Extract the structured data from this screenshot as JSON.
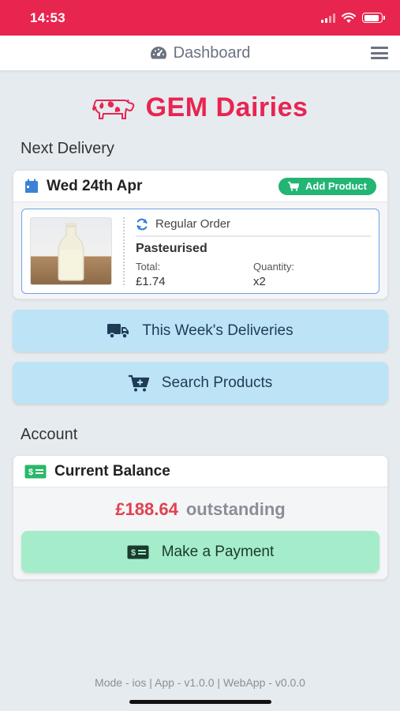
{
  "status_bar": {
    "time": "14:53",
    "battery_fraction": 0.9
  },
  "header": {
    "title": "Dashboard",
    "icon": "dashboard-gauge-icon",
    "menu_icon": "hamburger-menu-icon"
  },
  "brand": {
    "name": "GEM Dairies",
    "logo_icon": "cow-icon",
    "color": "#e8254f"
  },
  "next_delivery": {
    "section_title": "Next Delivery",
    "date": "Wed 24th Apr",
    "add_product_label": "Add Product",
    "order": {
      "type": "Regular Order",
      "product": "Pasteurised",
      "total_label": "Total:",
      "total_value": "£1.74",
      "quantity_label": "Quantity:",
      "quantity_value": "x2"
    }
  },
  "buttons": {
    "deliveries": "This Week's Deliveries",
    "search": "Search Products"
  },
  "account": {
    "section_title": "Account",
    "card_title": "Current Balance",
    "balance": "£188.64",
    "balance_status": "outstanding",
    "pay_label": "Make a Payment"
  },
  "footer": {
    "text": "Mode - ios | App - v1.0.0 | WebApp - v0.0.0"
  },
  "colors": {
    "accent": "#e8254f",
    "success": "#22b573",
    "info_button": "#bde3f6",
    "pay_button": "#a5eccb"
  }
}
